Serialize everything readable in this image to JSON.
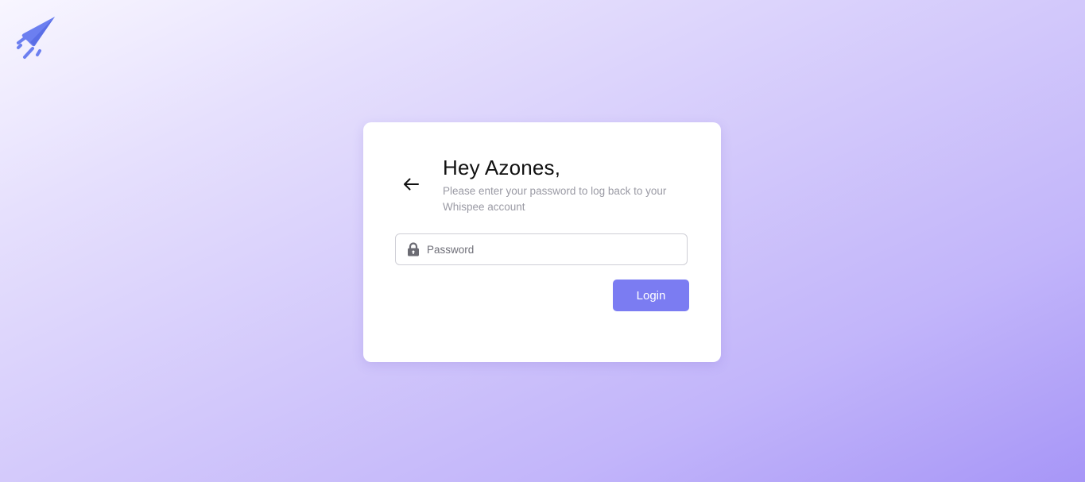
{
  "brand": {
    "logo_icon": "paper-plane-rocket-icon",
    "accent_color": "#7b7cf2",
    "logo_color": "#6c7ff0"
  },
  "login_card": {
    "back_icon": "arrow-left-icon",
    "title": "Hey Azones,",
    "subtitle": "Please enter your password to log back to your Whispee account",
    "password": {
      "icon": "lock-icon",
      "placeholder": "Password",
      "value": ""
    },
    "login_label": "Login"
  }
}
